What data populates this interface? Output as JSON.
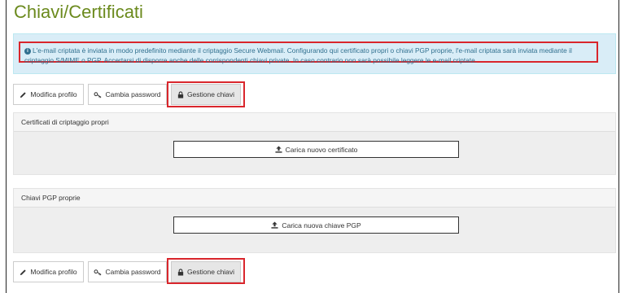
{
  "page": {
    "title": "Chiavi/Certificati"
  },
  "info": {
    "icon": "info-circle-icon",
    "text": "L'e-mail criptata è inviata in modo predefinito mediante il criptaggio Secure Webmail. Configurando qui certificato propri o chiavi PGP proprie, l'e-mail criptata sarà inviata mediante il criptaggio S/MIME o PGP. Accertarsi di disporre anche delle corrispondenti chiavi private. In caso contrario non sarà possibile leggere le e-mail criptate."
  },
  "tabs": [
    {
      "label": "Modifica profilo",
      "icon": "pencil-icon"
    },
    {
      "label": "Cambia password",
      "icon": "key-icon"
    },
    {
      "label": "Gestione chiavi",
      "icon": "lock-icon",
      "active": true
    }
  ],
  "sections": {
    "certificates": {
      "title": "Certificati di criptaggio propri",
      "button": "Carica nuovo certificato",
      "icon": "upload-icon"
    },
    "pgp": {
      "title": "Chiavi PGP proprie",
      "button": "Carica nuova chiave PGP",
      "icon": "upload-icon"
    }
  },
  "colors": {
    "title": "#6b8a1d",
    "info_bg": "#d9edf7",
    "info_text": "#31708f",
    "highlight": "#d9262c"
  }
}
